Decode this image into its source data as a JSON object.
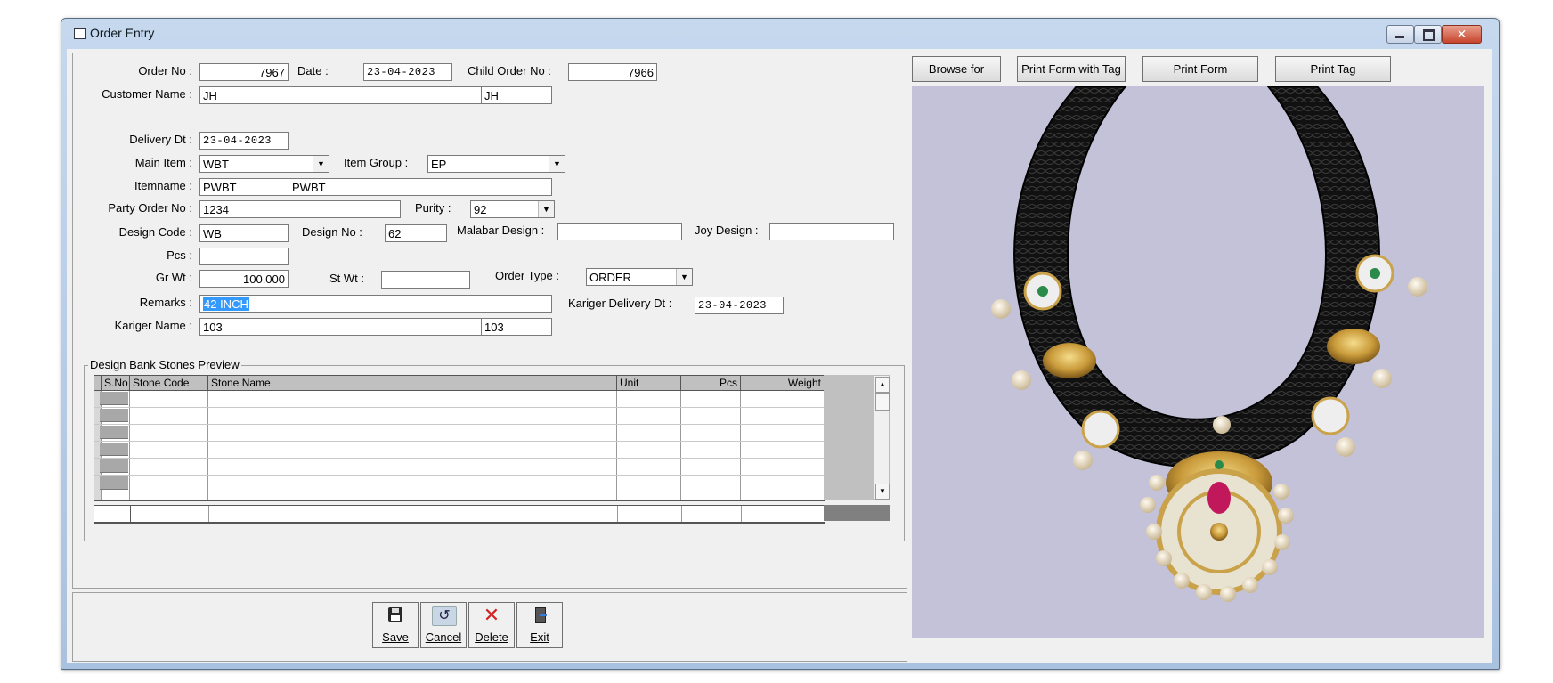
{
  "window": {
    "title": "Order Entry"
  },
  "form": {
    "order_no_label": "Order No :",
    "order_no": "7967",
    "date_label": "Date :",
    "date": "23-04-2023",
    "child_order_no_label": "Child Order No :",
    "child_order_no": "7966",
    "customer_name_label": "Customer Name :",
    "customer_name": "JH",
    "customer_code": "JH",
    "delivery_dt_label": "Delivery Dt :",
    "delivery_dt": "23-04-2023",
    "main_item_label": "Main Item :",
    "main_item": "WBT",
    "item_group_label": "Item Group :",
    "item_group": "EP",
    "itemname_label": "Itemname :",
    "itemname_code": "PWBT",
    "itemname": "PWBT",
    "party_order_no_label": "Party Order No :",
    "party_order_no": "1234",
    "purity_label": "Purity :",
    "purity": "92",
    "design_code_label": "Design Code :",
    "design_code": "WB",
    "design_no_label": "Design No :",
    "design_no": "62",
    "malabar_design_label": "Malabar Design :",
    "malabar_design": "",
    "joy_design_label": "Joy Design :",
    "joy_design": "",
    "pcs_label": "Pcs :",
    "pcs": "",
    "gr_wt_label": "Gr Wt :",
    "gr_wt": "100.000",
    "st_wt_label": "St Wt :",
    "st_wt": "",
    "order_type_label": "Order Type :",
    "order_type": "ORDER",
    "remarks_label": "Remarks :",
    "remarks": "42 INCH",
    "kariger_delivery_dt_label": "Kariger Delivery Dt :",
    "kariger_delivery_dt": "23-04-2023",
    "kariger_name_label": "Kariger Name :",
    "kariger_name": "103",
    "kariger_code": "103"
  },
  "stones": {
    "group_title": "Design Bank Stones Preview",
    "columns": [
      "S.No",
      "Stone Code",
      "Stone Name",
      "Unit",
      "Pcs",
      "Weight"
    ]
  },
  "actions": {
    "save": "Save",
    "cancel": "Cancel",
    "delete": "Delete",
    "exit": "Exit"
  },
  "photo_panel": {
    "browse": "Browse for Photo",
    "print_form_with_tag": "Print Form with Tag",
    "print_form": "Print Form",
    "print_tag": "Print Tag"
  },
  "icons": {
    "save": "floppy-disk-icon",
    "cancel": "undo-icon",
    "delete": "red-x-icon",
    "exit": "exit-door-icon"
  },
  "colors": {
    "selection": "#3399ff",
    "delete_red": "#d42020"
  }
}
